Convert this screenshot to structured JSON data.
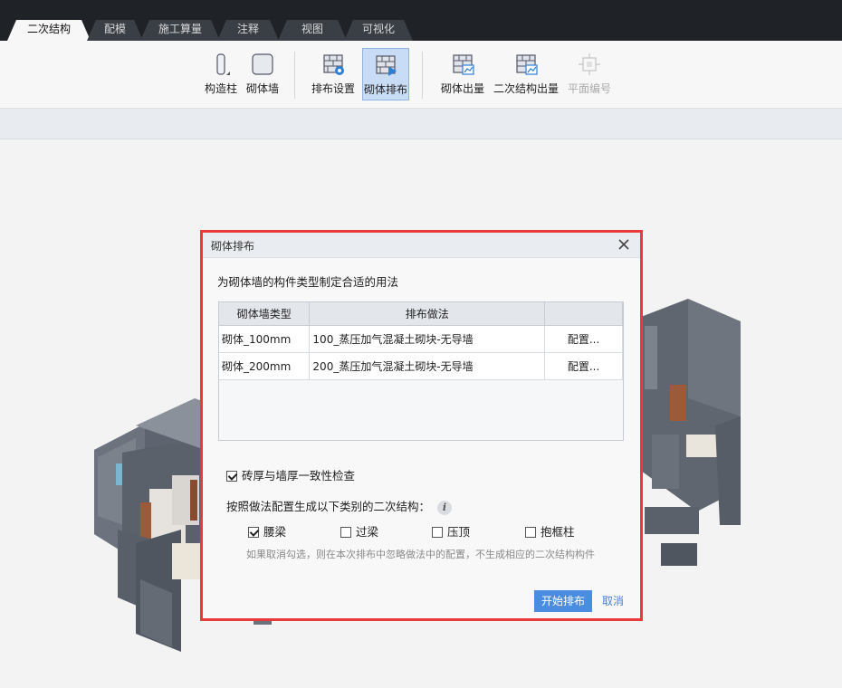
{
  "tabs": [
    {
      "label": "二次结构",
      "active": true
    },
    {
      "label": "配模",
      "active": false
    },
    {
      "label": "施工算量",
      "active": false
    },
    {
      "label": "注释",
      "active": false
    },
    {
      "label": "视图",
      "active": false
    },
    {
      "label": "可视化",
      "active": false
    }
  ],
  "ribbon": {
    "column": "构造柱",
    "wall": "砌体墙",
    "layout_settings": "排布设置",
    "masonry_layout": "砌体排布",
    "masonry_output": "砌体出量",
    "secondary_output": "二次结构出量",
    "plan_number": "平面编号"
  },
  "dialog": {
    "title": "砌体排布",
    "description": "为砌体墙的构件类型制定合适的用法",
    "table": {
      "headers": [
        "砌体墙类型",
        "排布做法",
        ""
      ],
      "rows": [
        {
          "type": "砌体_100mm",
          "method": "100_蒸压加气混凝土砌块-无导墙",
          "action": "配置..."
        },
        {
          "type": "砌体_200mm",
          "method": "200_蒸压加气混凝土砌块-无导墙",
          "action": "配置..."
        }
      ]
    },
    "thickness_check": {
      "label": "砖厚与墙厚一致性检查",
      "checked": true
    },
    "generate_label": "按照做法配置生成以下类别的二次结构：",
    "options": [
      {
        "label": "腰梁",
        "checked": true
      },
      {
        "label": "过梁",
        "checked": false
      },
      {
        "label": "压顶",
        "checked": false
      },
      {
        "label": "抱框柱",
        "checked": false
      }
    ],
    "hint": "如果取消勾选，则在本次排布中忽略做法中的配置，不生成相应的二次结构构件",
    "start_button": "开始排布",
    "cancel_button": "取消"
  },
  "colors": {
    "accent": "#4a8de0",
    "highlight": "#e83a3a",
    "tabbar": "#1f2328"
  }
}
